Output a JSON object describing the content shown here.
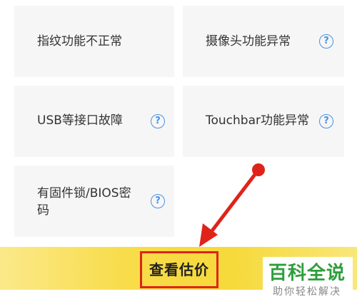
{
  "options": [
    {
      "label": "指纹功能不正常",
      "has_help": false
    },
    {
      "label": "摄像头功能异常",
      "has_help": true
    },
    {
      "label": "USB等接口故障",
      "has_help": true
    },
    {
      "label": "Touchbar功能异常",
      "has_help": true
    },
    {
      "label_line1": "有固件锁/BIOS密",
      "label_line2": "码",
      "has_help": true
    }
  ],
  "help_icon_glyph": "?",
  "action": {
    "estimate_label": "查看估价"
  },
  "watermark": {
    "title": "百科全说",
    "subtitle": "助你轻松解决"
  },
  "colors": {
    "card_bg": "#f6f6f6",
    "help_icon": "#4a90e2",
    "bar_yellow": "#f6d93a",
    "highlight_red": "#e0231a",
    "watermark_green": "#2e9e3c"
  }
}
